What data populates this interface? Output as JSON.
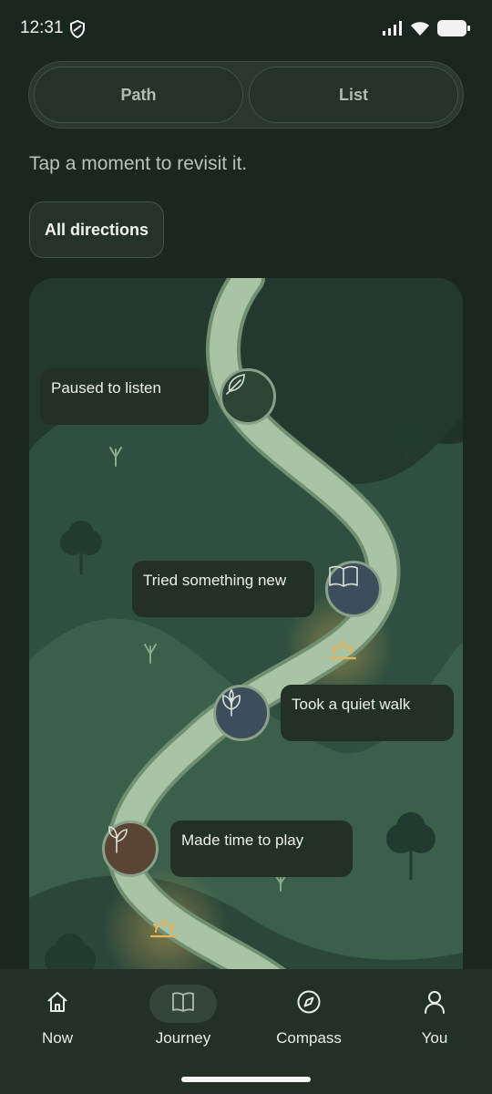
{
  "status_bar": {
    "time": "12:31"
  },
  "segment": {
    "path_label": "Path",
    "list_label": "List",
    "selected": "Path"
  },
  "hint": "Tap a moment to revisit it.",
  "filter": {
    "label": "All directions"
  },
  "moments": [
    {
      "label": "Paused to listen",
      "icon": "feather-icon"
    },
    {
      "label": "Tried something new",
      "icon": "book-icon"
    },
    {
      "label": "Took a quiet walk",
      "icon": "leaf-icon"
    },
    {
      "label": "Made time to play",
      "icon": "sprout-icon"
    }
  ],
  "nav": {
    "items": [
      {
        "label": "Now",
        "icon": "home-icon"
      },
      {
        "label": "Journey",
        "icon": "map-book-icon",
        "active": true
      },
      {
        "label": "Compass",
        "icon": "compass-icon"
      },
      {
        "label": "You",
        "icon": "person-icon"
      }
    ]
  },
  "colors": {
    "background": "#1a2620",
    "map_green": "#2f5040",
    "path": "#a9c4a4",
    "sun": "#e7b45a",
    "node_slate": "#3e4d5c",
    "node_brown": "#5a4535"
  }
}
